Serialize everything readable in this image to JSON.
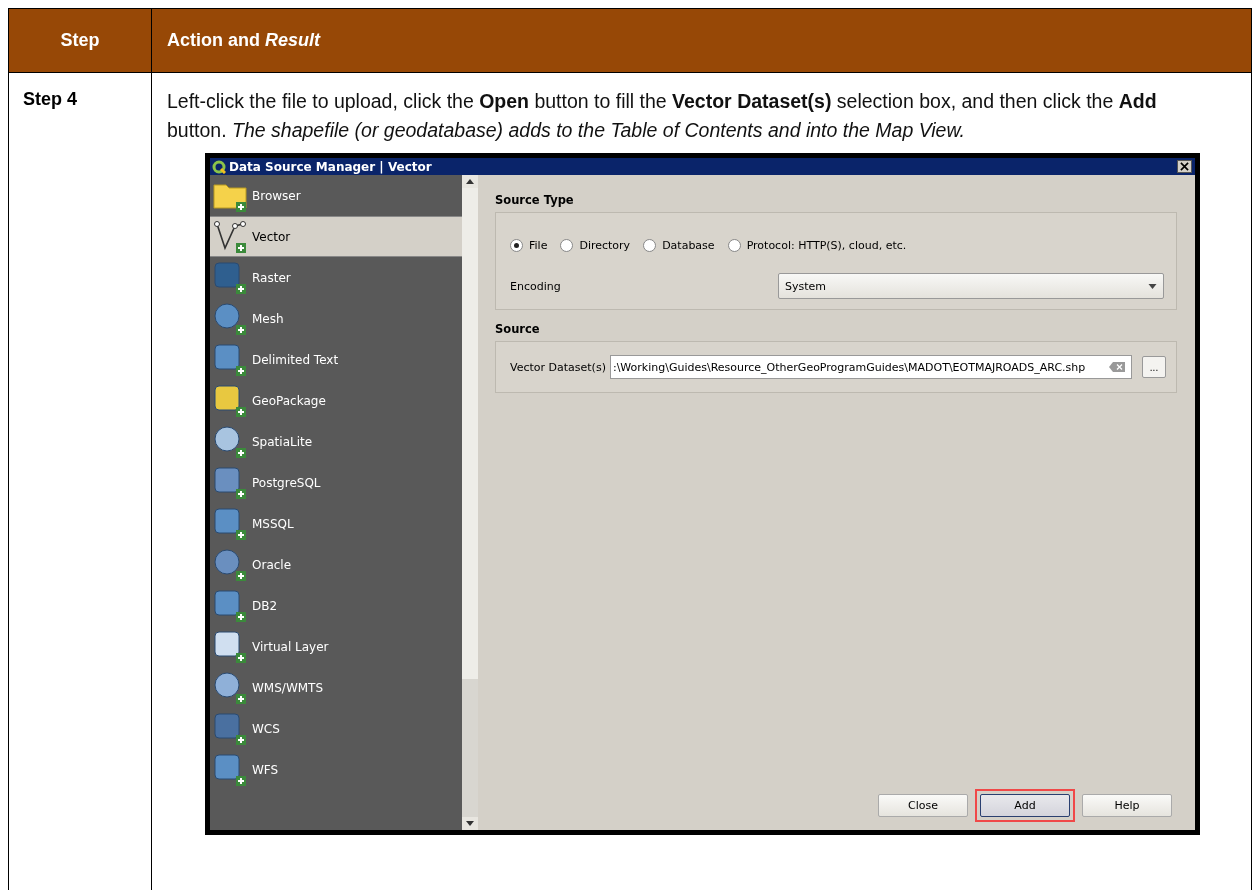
{
  "table": {
    "columns": [
      "Step",
      "Action and *Result*"
    ],
    "rows": [
      {
        "step": "Step 4",
        "action": "Left-click the file to upload, click the **Open** button to fill the **Vector Dataset(s)** selection box, and then click the **Add** button. *The shapefile (or geodatabase) adds to the Table of Contents and into the Map View.*"
      }
    ]
  },
  "dialog": {
    "title": "Data Source Manager | Vector",
    "sidebar": [
      {
        "label": "Browser",
        "selected": false
      },
      {
        "label": "Vector",
        "selected": true
      },
      {
        "label": "Raster",
        "selected": false
      },
      {
        "label": "Mesh",
        "selected": false
      },
      {
        "label": "Delimited Text",
        "selected": false
      },
      {
        "label": "GeoPackage",
        "selected": false
      },
      {
        "label": "SpatiaLite",
        "selected": false
      },
      {
        "label": "PostgreSQL",
        "selected": false
      },
      {
        "label": "MSSQL",
        "selected": false
      },
      {
        "label": "Oracle",
        "selected": false
      },
      {
        "label": "DB2",
        "selected": false
      },
      {
        "label": "Virtual Layer",
        "selected": false
      },
      {
        "label": "WMS/WMTS",
        "selected": false
      },
      {
        "label": "WCS",
        "selected": false
      },
      {
        "label": "WFS",
        "selected": false
      }
    ],
    "source_type": {
      "heading": "Source Type",
      "options": [
        {
          "label": "File",
          "selected": true
        },
        {
          "label": "Directory",
          "selected": false
        },
        {
          "label": "Database",
          "selected": false
        },
        {
          "label": "Protocol: HTTP(S), cloud, etc.",
          "selected": false
        }
      ],
      "encoding_label": "Encoding",
      "encoding_value": "System"
    },
    "source": {
      "heading": "Source",
      "dataset_label": "Vector Dataset(s)",
      "dataset_value": ":\\Working\\Guides\\Resource_OtherGeoProgramGuides\\MADOT\\EOTMAJROADS_ARC.shp",
      "browse": "..."
    },
    "buttons": [
      {
        "label": "Close",
        "highlighted": false
      },
      {
        "label": "Add",
        "highlighted": true
      },
      {
        "label": "Help",
        "highlighted": false
      }
    ]
  }
}
